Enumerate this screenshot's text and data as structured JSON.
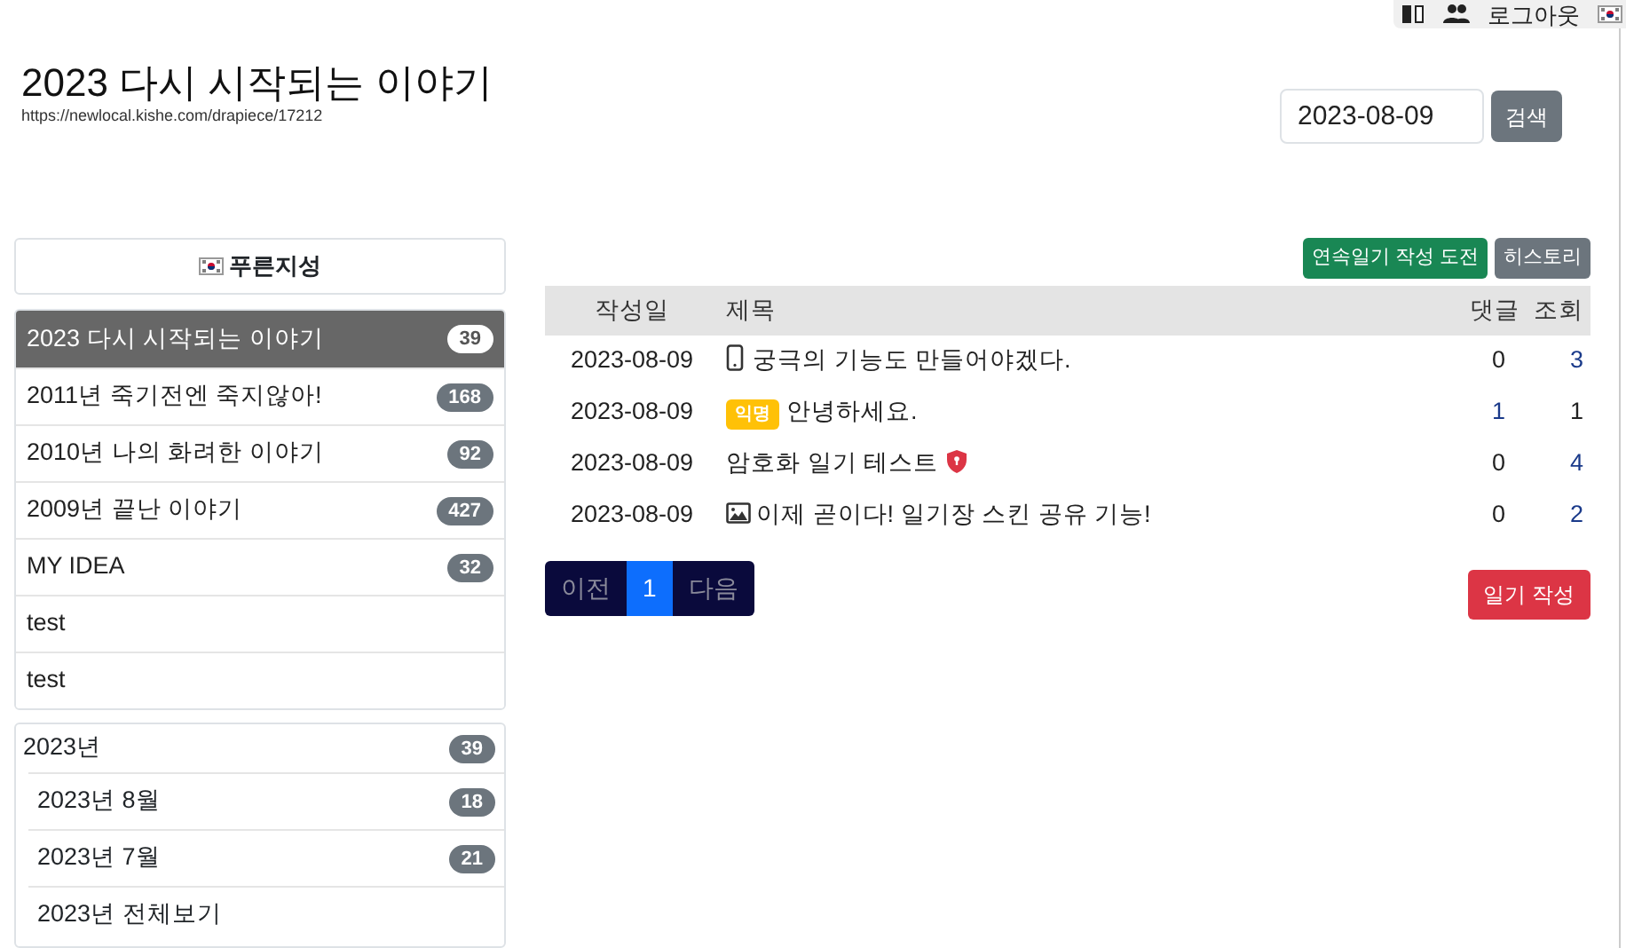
{
  "top_bar": {
    "logout": "로그아웃"
  },
  "header": {
    "title": "2023 다시 시작되는 이야기",
    "url": "https://newlocal.kishe.com/drapiece/17212"
  },
  "search": {
    "value": "2023-08-09",
    "button": "검색"
  },
  "profile": {
    "name": "푸른지성"
  },
  "diaries": [
    {
      "label": "2023 다시 시작되는 이야기",
      "count": "39",
      "selected": true
    },
    {
      "label": "2011년 죽기전엔 죽지않아!",
      "count": "168",
      "selected": false
    },
    {
      "label": "2010년 나의 화려한 이야기",
      "count": "92",
      "selected": false
    },
    {
      "label": "2009년 끝난 이야기",
      "count": "427",
      "selected": false
    },
    {
      "label": "MY IDEA",
      "count": "32",
      "selected": false
    },
    {
      "label": "test",
      "selected": false
    },
    {
      "label": "test",
      "selected": false
    }
  ],
  "archive": [
    {
      "label": "2023년",
      "count": "39",
      "children": [
        {
          "label": "2023년 8월",
          "count": "18"
        },
        {
          "label": "2023년 7월",
          "count": "21"
        },
        {
          "label": "2023년 전체보기"
        }
      ]
    }
  ],
  "actions": [
    "연속일기 작성 도전",
    "히스토리"
  ],
  "table": {
    "columns": [
      "작성일",
      "제목",
      "댓글",
      "조회"
    ],
    "rows": [
      {
        "date": "2023-08-09",
        "kind": "phone",
        "title": "궁극의 기능도 만들어야겠다.",
        "comments": "0",
        "views": "3"
      },
      {
        "date": "2023-08-09",
        "kind": "anonymous",
        "tag": "익명",
        "title": "안녕하세요.",
        "comments": "1",
        "views": "1"
      },
      {
        "date": "2023-08-09",
        "kind": "locked",
        "title": "암호화 일기 테스트",
        "comments": "0",
        "views": "4"
      },
      {
        "date": "2023-08-09",
        "kind": "image",
        "title": "이제 곧이다! 일기장 스킨 공유 기능!",
        "comments": "0",
        "views": "2"
      }
    ]
  },
  "pagination": [
    {
      "label": "이전",
      "selected": false
    },
    {
      "label": "1",
      "selected": true
    },
    {
      "label": "다음",
      "selected": false
    }
  ],
  "write_button": "일기 작성"
}
